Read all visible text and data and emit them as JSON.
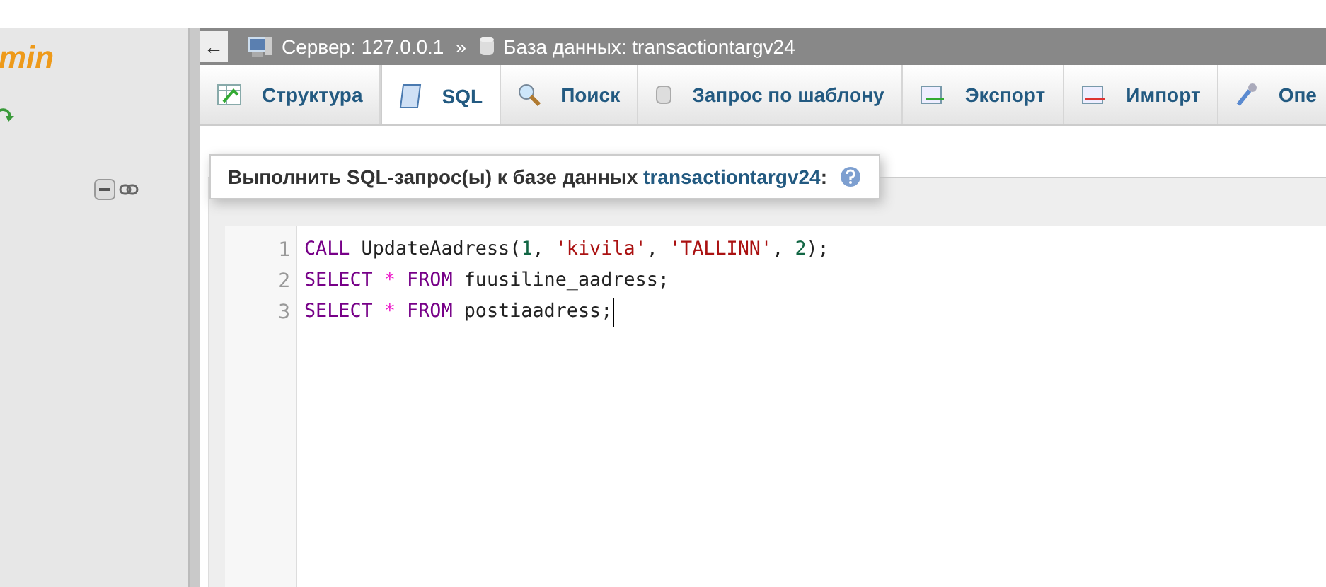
{
  "sidebar": {
    "logo_text": "min"
  },
  "breadcrumb": {
    "back": "←",
    "items": [
      {
        "kind": "server",
        "text": "Сервер: 127.0.0.1"
      },
      {
        "kind": "database",
        "text": "База данных: transactiontargv24"
      }
    ],
    "separator": "»"
  },
  "tabs": [
    {
      "label": "Структура",
      "kind": "structure",
      "selected": false
    },
    {
      "label": "SQL",
      "kind": "sql",
      "selected": true
    },
    {
      "label": "Поиск",
      "kind": "search",
      "selected": false
    },
    {
      "label": "Запрос по шаблону",
      "kind": "query",
      "selected": false
    },
    {
      "label": "Экспорт",
      "kind": "export",
      "selected": false
    },
    {
      "label": "Импорт",
      "kind": "import",
      "selected": false
    },
    {
      "label": "Опе",
      "kind": "operations",
      "selected": false
    }
  ],
  "query_panel": {
    "legend": "Выполнить SQL-запрос(ы) к базе данных ",
    "database": "transactiontargv24",
    "legend_end": ":"
  },
  "editor": {
    "lines": [
      {
        "number": "1",
        "tokens": [
          {
            "kind": "keyword",
            "text": "CALL"
          },
          {
            "kind": "plain",
            "text": " UpdateAadress("
          },
          {
            "kind": "number",
            "text": "1"
          },
          {
            "kind": "plain",
            "text": ", "
          },
          {
            "kind": "string",
            "text": "'kivila'"
          },
          {
            "kind": "plain",
            "text": ", "
          },
          {
            "kind": "string",
            "text": "'TALLINN'"
          },
          {
            "kind": "plain",
            "text": ", "
          },
          {
            "kind": "number",
            "text": "2"
          },
          {
            "kind": "plain",
            "text": ");"
          }
        ]
      },
      {
        "number": "2",
        "tokens": [
          {
            "kind": "keyword",
            "text": "SELECT"
          },
          {
            "kind": "operator",
            "text": " *"
          },
          {
            "kind": "keyword",
            "text": " FROM"
          },
          {
            "kind": "plain",
            "text": " fuusiline_aadress;"
          }
        ]
      },
      {
        "number": "3",
        "tokens": [
          {
            "kind": "keyword",
            "text": "SELECT"
          },
          {
            "kind": "operator",
            "text": " *"
          },
          {
            "kind": "keyword",
            "text": " FROM"
          },
          {
            "kind": "plain",
            "text": " postiaadress;"
          }
        ],
        "cursor": true
      }
    ]
  }
}
